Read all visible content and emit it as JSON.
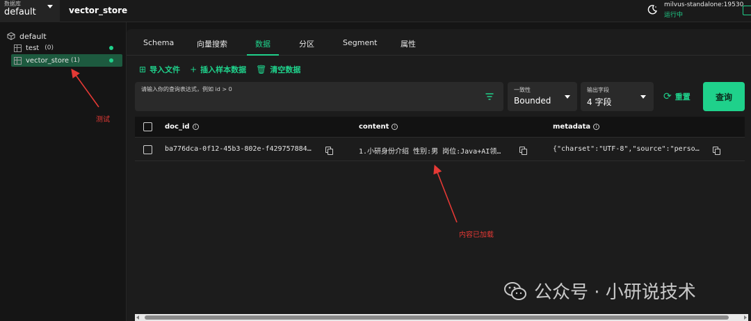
{
  "topbar": {
    "db_label": "数据库",
    "db_value": "default",
    "collection_title": "vector_store",
    "server_name": "milvus-standalone:19530",
    "server_status": "运行中"
  },
  "sidebar": {
    "root": "default",
    "items": [
      {
        "label": "test",
        "count": "(0)"
      },
      {
        "label": "vector_store",
        "count": "(1)"
      }
    ]
  },
  "tabs": [
    "Schema",
    "向量搜索",
    "数据",
    "分区",
    "Segment",
    "属性"
  ],
  "active_tab": "数据",
  "actions": {
    "import": "导入文件",
    "insert_sample": "插入样本数据",
    "clear": "清空数据"
  },
  "query": {
    "placeholder": "请输入你的查询表达式，例如 id > 0"
  },
  "consistency": {
    "label": "一致性",
    "value": "Bounded"
  },
  "output_fields": {
    "label": "输出字段",
    "value": "4 字段"
  },
  "buttons": {
    "reset": "重置",
    "query": "查询"
  },
  "table": {
    "columns": [
      "doc_id",
      "content",
      "metadata"
    ],
    "rows": [
      {
        "doc_id": "ba776dca-0f12-45b3-802e-f429757884…",
        "content": "1.小研身份介绍 性别:男 岗位:Java+AI领…",
        "metadata": "{\"charset\":\"UTF-8\",\"source\":\"perso…"
      }
    ]
  },
  "annotations": {
    "sidebar_note": "测试",
    "content_note": "内容已加载"
  },
  "watermark": "公众号 · 小研说技术",
  "colors": {
    "accent": "#1fd18b",
    "annotation": "#e53935",
    "background": "#151515",
    "panel": "#1c1c1c"
  }
}
